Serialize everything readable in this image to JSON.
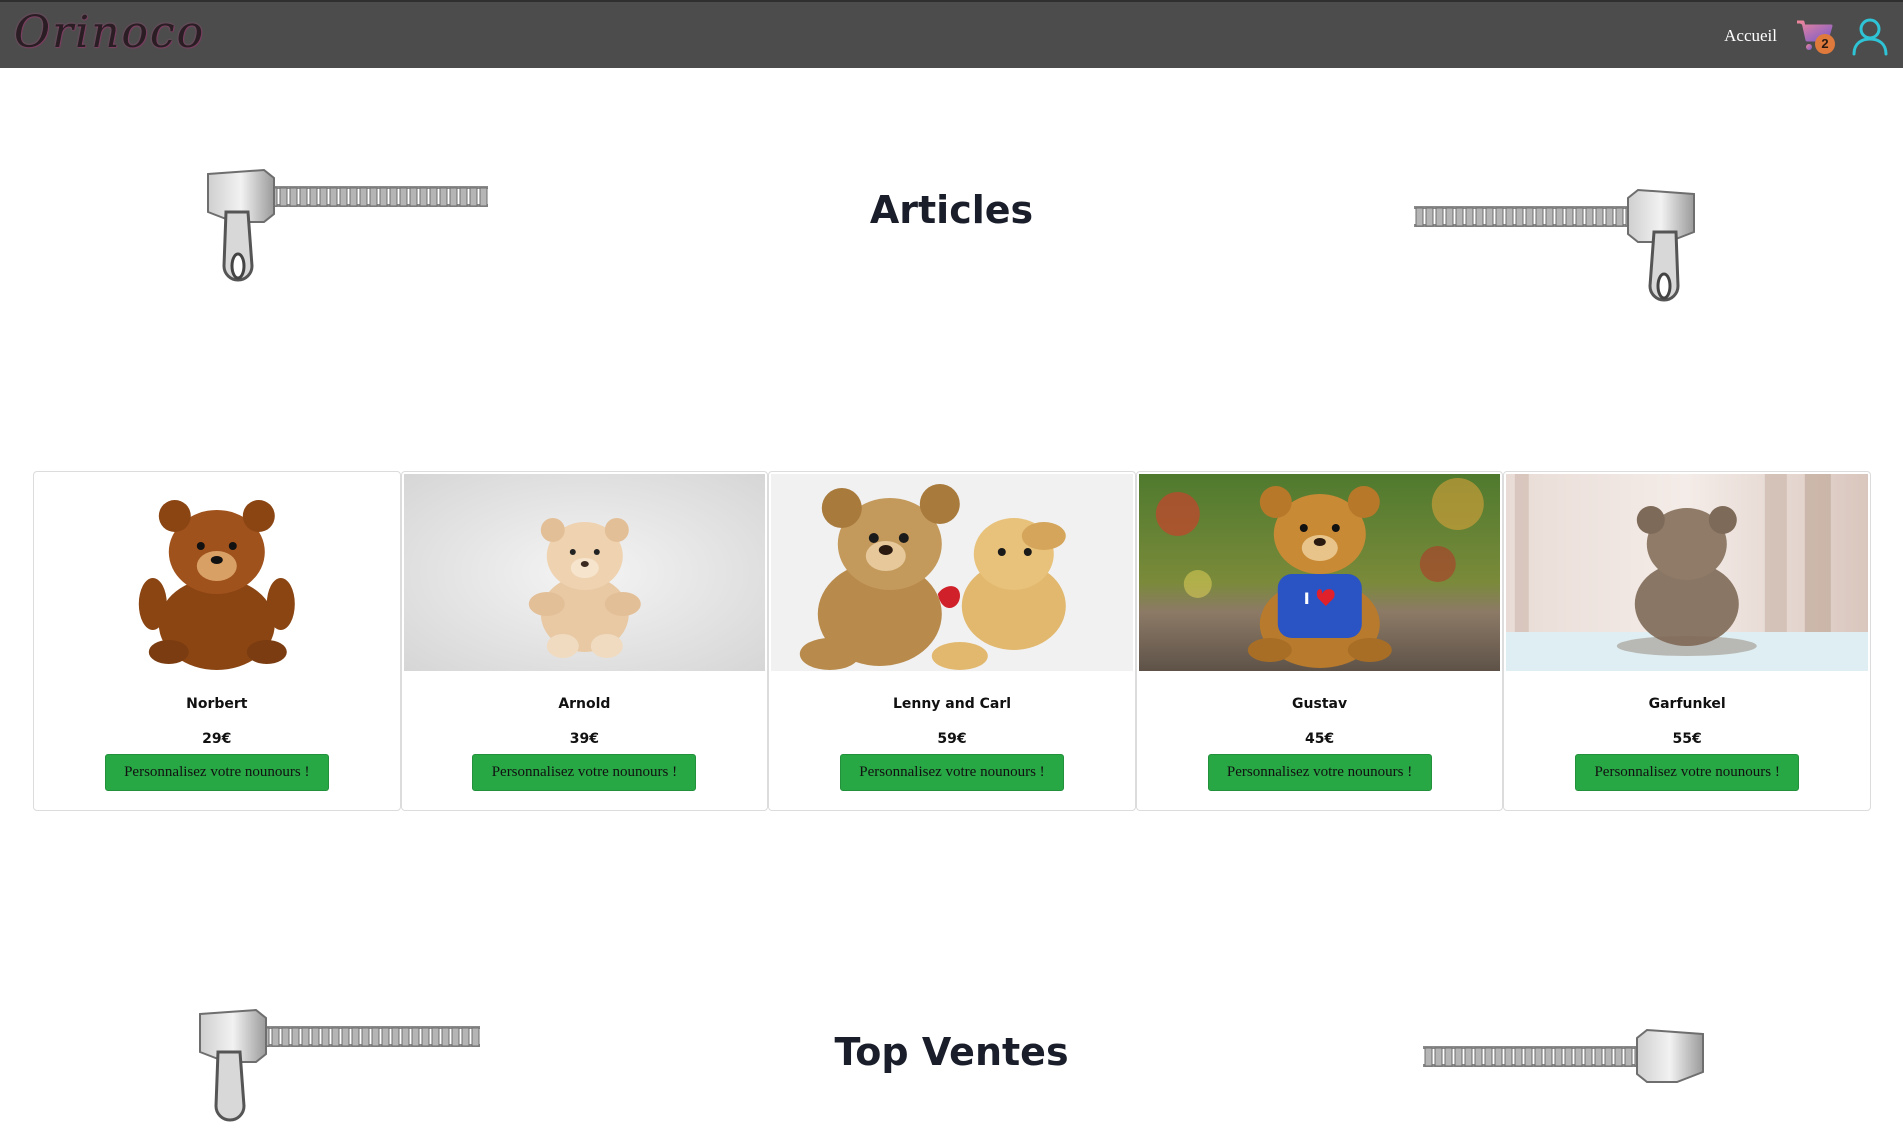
{
  "navbar": {
    "brand": "Orinoco",
    "home_link": "Accueil",
    "cart_count": "2",
    "cart_icon": "shopping-cart-icon",
    "user_icon": "user-icon"
  },
  "sections": {
    "articles_title": "Articles",
    "top_sales_title": "Top Ventes",
    "decoration_icon": "zipper-icon"
  },
  "products": [
    {
      "name": "Norbert",
      "price": "29€",
      "button_label": "Personnalisez votre nounours !"
    },
    {
      "name": "Arnold",
      "price": "39€",
      "button_label": "Personnalisez votre nounours !"
    },
    {
      "name": "Lenny and Carl",
      "price": "59€",
      "button_label": "Personnalisez votre nounours !"
    },
    {
      "name": "Gustav",
      "price": "45€",
      "button_label": "Personnalisez votre nounours !"
    },
    {
      "name": "Garfunkel",
      "price": "55€",
      "button_label": "Personnalisez votre nounours !"
    }
  ],
  "colors": {
    "navbar_bg": "#4c4c4c",
    "button_bg": "#28a745",
    "cart_gradient_start": "#f0869a",
    "cart_gradient_end": "#7b5cc9",
    "cart_badge": "#e07a3c",
    "user_icon_color": "#2ec4d6"
  }
}
